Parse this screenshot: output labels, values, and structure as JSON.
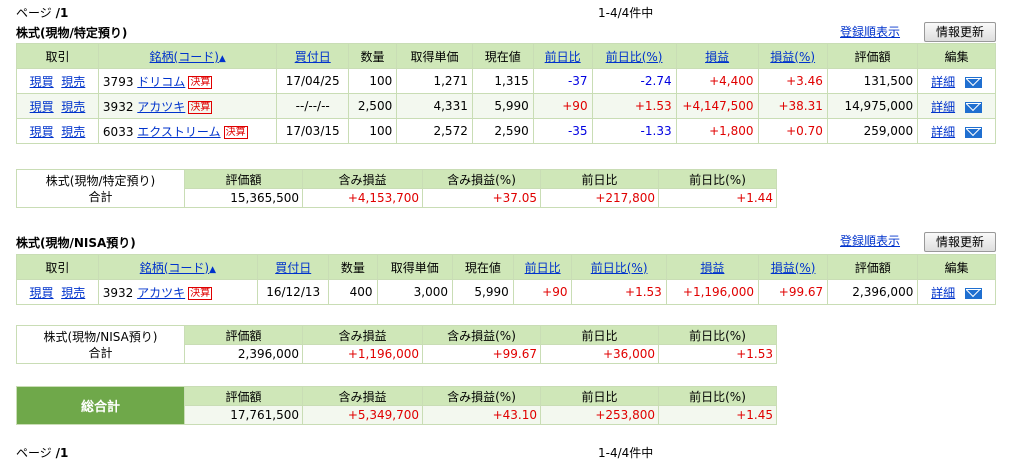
{
  "paging": {
    "page_label": "ページ",
    "page_num": "/1",
    "count": "1-4/4件中"
  },
  "buttons": {
    "sort_link": "登録順表示",
    "refresh": "情報更新"
  },
  "columns": [
    "取引",
    "銘柄(コード)",
    "買付日",
    "数量",
    "取得単価",
    "現在値",
    "前日比",
    "前日比(%)",
    "損益",
    "損益(%)",
    "評価額",
    "編集"
  ],
  "action_links": {
    "buy": "現買",
    "sell": "現売",
    "detail": "詳細",
    "kessan": "決算"
  },
  "sections": [
    {
      "title": "株式(現物/特定預り)",
      "rows": [
        {
          "code": "3793",
          "name": "ドリコム",
          "kessan": true,
          "date": "17/04/25",
          "qty": "100",
          "cost": "1,271",
          "price": "1,315",
          "chg": "-37",
          "chg_pct": "-2.74",
          "pl": "+4,400",
          "pl_pct": "+3.46",
          "value": "131,500"
        },
        {
          "code": "3932",
          "name": "アカツキ",
          "kessan": true,
          "date": "--/--/--",
          "qty": "2,500",
          "cost": "4,331",
          "price": "5,990",
          "chg": "+90",
          "chg_pct": "+1.53",
          "pl": "+4,147,500",
          "pl_pct": "+38.31",
          "value": "14,975,000"
        },
        {
          "code": "6033",
          "name": "エクストリーム",
          "kessan": true,
          "date": "17/03/15",
          "qty": "100",
          "cost": "2,572",
          "price": "2,590",
          "chg": "-35",
          "chg_pct": "-1.33",
          "pl": "+1,800",
          "pl_pct": "+0.70",
          "value": "259,000"
        }
      ],
      "summary": {
        "label1": "株式(現物/特定預り)",
        "label2": "合計",
        "value": "15,365,500",
        "pl": "+4,153,700",
        "pl_pct": "+37.05",
        "chg": "+217,800",
        "chg_pct": "+1.44"
      }
    },
    {
      "title": "株式(現物/NISA預り)",
      "rows": [
        {
          "code": "3932",
          "name": "アカツキ",
          "kessan": true,
          "date": "16/12/13",
          "qty": "400",
          "cost": "3,000",
          "price": "5,990",
          "chg": "+90",
          "chg_pct": "+1.53",
          "pl": "+1,196,000",
          "pl_pct": "+99.67",
          "value": "2,396,000"
        }
      ],
      "summary": {
        "label1": "株式(現物/NISA預り)",
        "label2": "合計",
        "value": "2,396,000",
        "pl": "+1,196,000",
        "pl_pct": "+99.67",
        "chg": "+36,000",
        "chg_pct": "+1.53"
      }
    }
  ],
  "summary_headers": [
    "評価額",
    "含み損益",
    "含み損益(%)",
    "前日比",
    "前日比(%)"
  ],
  "grand_total": {
    "label": "総合計",
    "value": "17,761,500",
    "pl": "+5,349,700",
    "pl_pct": "+43.10",
    "chg": "+253,800",
    "chg_pct": "+1.45"
  }
}
